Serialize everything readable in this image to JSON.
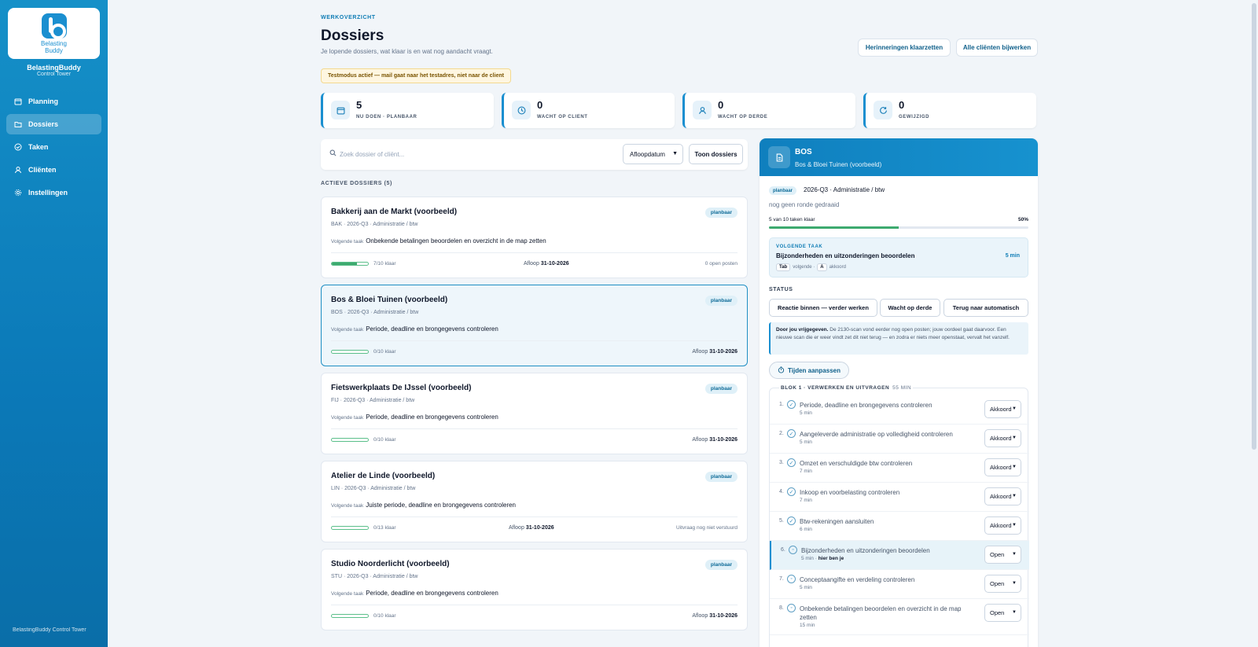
{
  "sidebar": {
    "logo_text_1": "Belasting",
    "logo_text_2": "Buddy",
    "brand_name": "BelastingBuddy",
    "brand_sub": "Control Tower",
    "items": [
      {
        "label": "Planning",
        "icon": "calendar-icon"
      },
      {
        "label": "Dossiers",
        "icon": "folder-icon"
      },
      {
        "label": "Taken",
        "icon": "check-circle-icon"
      },
      {
        "label": "Cliënten",
        "icon": "user-icon"
      },
      {
        "label": "Instellingen",
        "icon": "gear-icon"
      }
    ],
    "footer": "BelastingBuddy Control Tower"
  },
  "header": {
    "eyebrow": "WERKOVERZICHT",
    "title": "Dossiers",
    "subtitle": "Je lopende dossiers, wat klaar is en wat nog aandacht vraagt.",
    "btn_reminders": "Herinneringen klaarzetten",
    "btn_update_all": "Alle cliënten bijwerken",
    "testmode": "Testmodus actief — mail gaat naar het testadres, niet naar de client"
  },
  "stats": [
    {
      "num": "5",
      "label": "NU DOEN · PLANBAAR"
    },
    {
      "num": "0",
      "label": "WACHT OP CLIENT"
    },
    {
      "num": "0",
      "label": "WACHT OP DERDE"
    },
    {
      "num": "0",
      "label": "GEWIJZIGD"
    }
  ],
  "search": {
    "placeholder": "Zoek dossier of cliënt...",
    "sort_value": "Afloopdatum",
    "show_button": "Toon dossiers"
  },
  "list": {
    "section_title": "ACTIEVE DOSSIERS (5)",
    "next_label": "Volgende taak",
    "due_label": "Afloop",
    "dossiers": [
      {
        "title": "Bakkerij aan de Markt (voorbeeld)",
        "meta": "BAK · 2026-Q3 · Administratie / btw",
        "badge": "planbaar",
        "next": "Onbekende betalingen beoordelen en overzicht in de map zetten",
        "progress": "7/10 klaar",
        "fraction": 0.7,
        "due": "31-10-2026",
        "extra": "0 open posten"
      },
      {
        "title": "Bos & Bloei Tuinen (voorbeeld)",
        "meta": "BOS · 2026-Q3 · Administratie / btw",
        "badge": "planbaar",
        "next": "Periode, deadline en brongegevens controleren",
        "progress": "0/10 klaar",
        "fraction": 0,
        "due": "31-10-2026",
        "extra": ""
      },
      {
        "title": "Fietswerkplaats De IJssel (voorbeeld)",
        "meta": "FIJ · 2026-Q3 · Administratie / btw",
        "badge": "planbaar",
        "next": "Periode, deadline en brongegevens controleren",
        "progress": "0/10 klaar",
        "fraction": 0,
        "due": "31-10-2026",
        "extra": ""
      },
      {
        "title": "Atelier de Linde (voorbeeld)",
        "meta": "LIN · 2026-Q3 · Administratie / btw",
        "badge": "planbaar",
        "next": "Juiste periode, deadline en brongegevens controleren",
        "progress": "0/13 klaar",
        "fraction": 0,
        "due": "31-10-2026",
        "extra": "Uitvraag nog niet verstuurd"
      },
      {
        "title": "Studio Noorderlicht (voorbeeld)",
        "meta": "STU · 2026-Q3 · Administratie / btw",
        "badge": "planbaar",
        "next": "Periode, deadline en brongegevens controleren",
        "progress": "0/10 klaar",
        "fraction": 0,
        "due": "31-10-2026",
        "extra": ""
      }
    ]
  },
  "panel": {
    "code": "BOS",
    "client": "Bos & Bloei Tuinen (voorbeeld)",
    "badge": "planbaar",
    "period": "2026-Q3 · Administratie / btw",
    "round": "nog geen ronde gedraaid",
    "progress_text": "5 van 10 taken klaar",
    "progress_pct": "50%",
    "progress_fraction": 0.5,
    "next_label": "VOLGENDE TAAK",
    "next_title": "Bijzonderheden en uitzonderingen beoordelen",
    "next_min": "5 min",
    "key_tab": "Tab",
    "key_tab_label": "volgende ·",
    "key_a": "A",
    "key_a_label": "akkoord",
    "status_label": "STATUS",
    "btn_reaction": "Reactie binnen — verder werken",
    "btn_wait_third": "Wacht op derde",
    "btn_back_auto": "Terug naar automatisch",
    "release_bold": "Door jou vrijgegeven.",
    "release_text": " De 2130-scan vond eerder nog open posten; jouw oordeel gaat daarvoor. Een nieuwe scan die er weer vindt zet dit niet terug — en zodra er niets meer openstaat, vervalt het vanzelf.",
    "times_btn": "Tijden aanpassen",
    "block_title": "BLOK 1 · VERWERKEN EN UITVRAGEN",
    "block_min": "55 MIN",
    "tasks": [
      {
        "num": "1.",
        "name": "Periode, deadline en brongegevens controleren",
        "min": "5 min",
        "status": "Akkoord",
        "here": ""
      },
      {
        "num": "2.",
        "name": "Aangeleverde administratie op volledigheid controleren",
        "min": "5 min",
        "status": "Akkoord",
        "here": ""
      },
      {
        "num": "3.",
        "name": "Omzet en verschuldigde btw controleren",
        "min": "7 min",
        "status": "Akkoord",
        "here": ""
      },
      {
        "num": "4.",
        "name": "Inkoop en voorbelasting controleren",
        "min": "7 min",
        "status": "Akkoord",
        "here": ""
      },
      {
        "num": "5.",
        "name": "Btw-rekeningen aansluiten",
        "min": "6 min",
        "status": "Akkoord",
        "here": ""
      },
      {
        "num": "6.",
        "name": "Bijzonderheden en uitzonderingen beoordelen",
        "min": "5 min ·",
        "status": "Open",
        "here": "hier ben je"
      },
      {
        "num": "7.",
        "name": "Conceptaangifte en verdeling controleren",
        "min": "5 min",
        "status": "Open",
        "here": ""
      },
      {
        "num": "8.",
        "name": "Onbekende betalingen beoordelen en overzicht in de map zetten",
        "min": "15 min",
        "status": "Open",
        "here": ""
      }
    ]
  }
}
